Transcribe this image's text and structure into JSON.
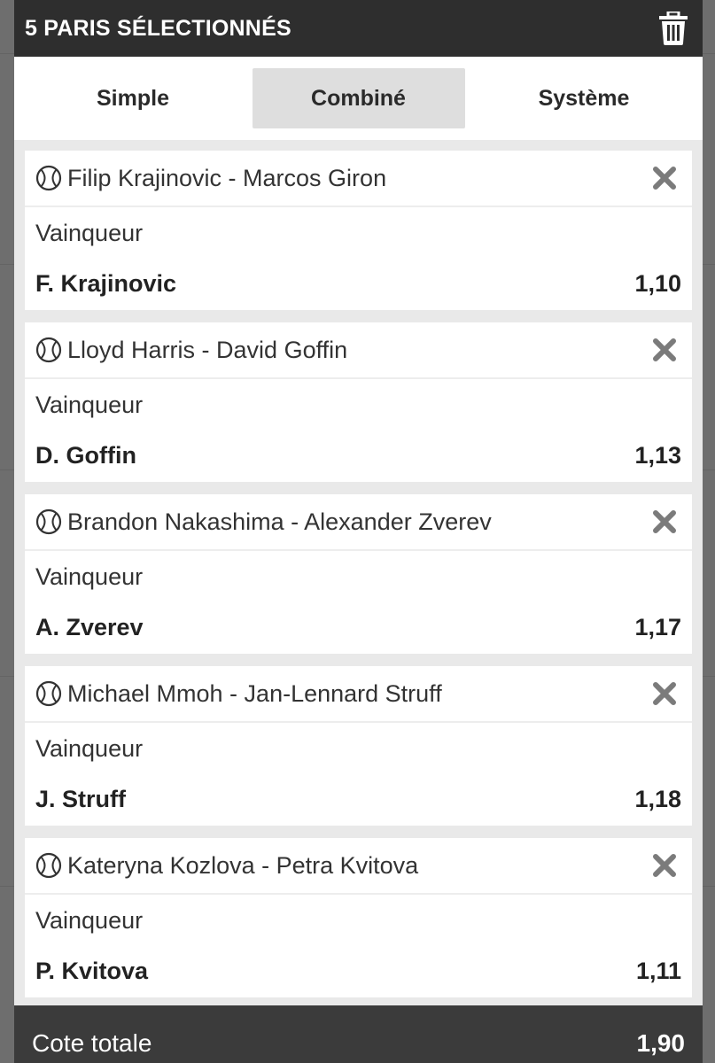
{
  "header": {
    "title": "5 PARIS SÉLECTIONNÉS",
    "trash_icon": "trash-icon"
  },
  "tabs": [
    {
      "label": "Simple",
      "active": false
    },
    {
      "label": "Combiné",
      "active": true
    },
    {
      "label": "Système",
      "active": false
    }
  ],
  "bets": [
    {
      "match": "Filip Krajinovic - Marcos Giron",
      "market": "Vainqueur",
      "selection": "F. Krajinovic",
      "odds": "1,10"
    },
    {
      "match": "Lloyd Harris - David Goffin",
      "market": "Vainqueur",
      "selection": "D. Goffin",
      "odds": "1,13"
    },
    {
      "match": "Brandon Nakashima - Alexander Zverev",
      "market": "Vainqueur",
      "selection": "A. Zverev",
      "odds": "1,17"
    },
    {
      "match": "Michael Mmoh - Jan-Lennard Struff",
      "market": "Vainqueur",
      "selection": "J. Struff",
      "odds": "1,18"
    },
    {
      "match": "Kateryna Kozlova - Petra Kvitova",
      "market": "Vainqueur",
      "selection": "P. Kvitova",
      "odds": "1,11"
    }
  ],
  "footer": {
    "label": "Cote totale",
    "value": "1,90"
  },
  "colors": {
    "header_bg": "#2e2e2e",
    "tab_active_bg": "#dedede",
    "footer_bg": "#3b3b3b",
    "panel_bg": "#e9e9e9"
  }
}
